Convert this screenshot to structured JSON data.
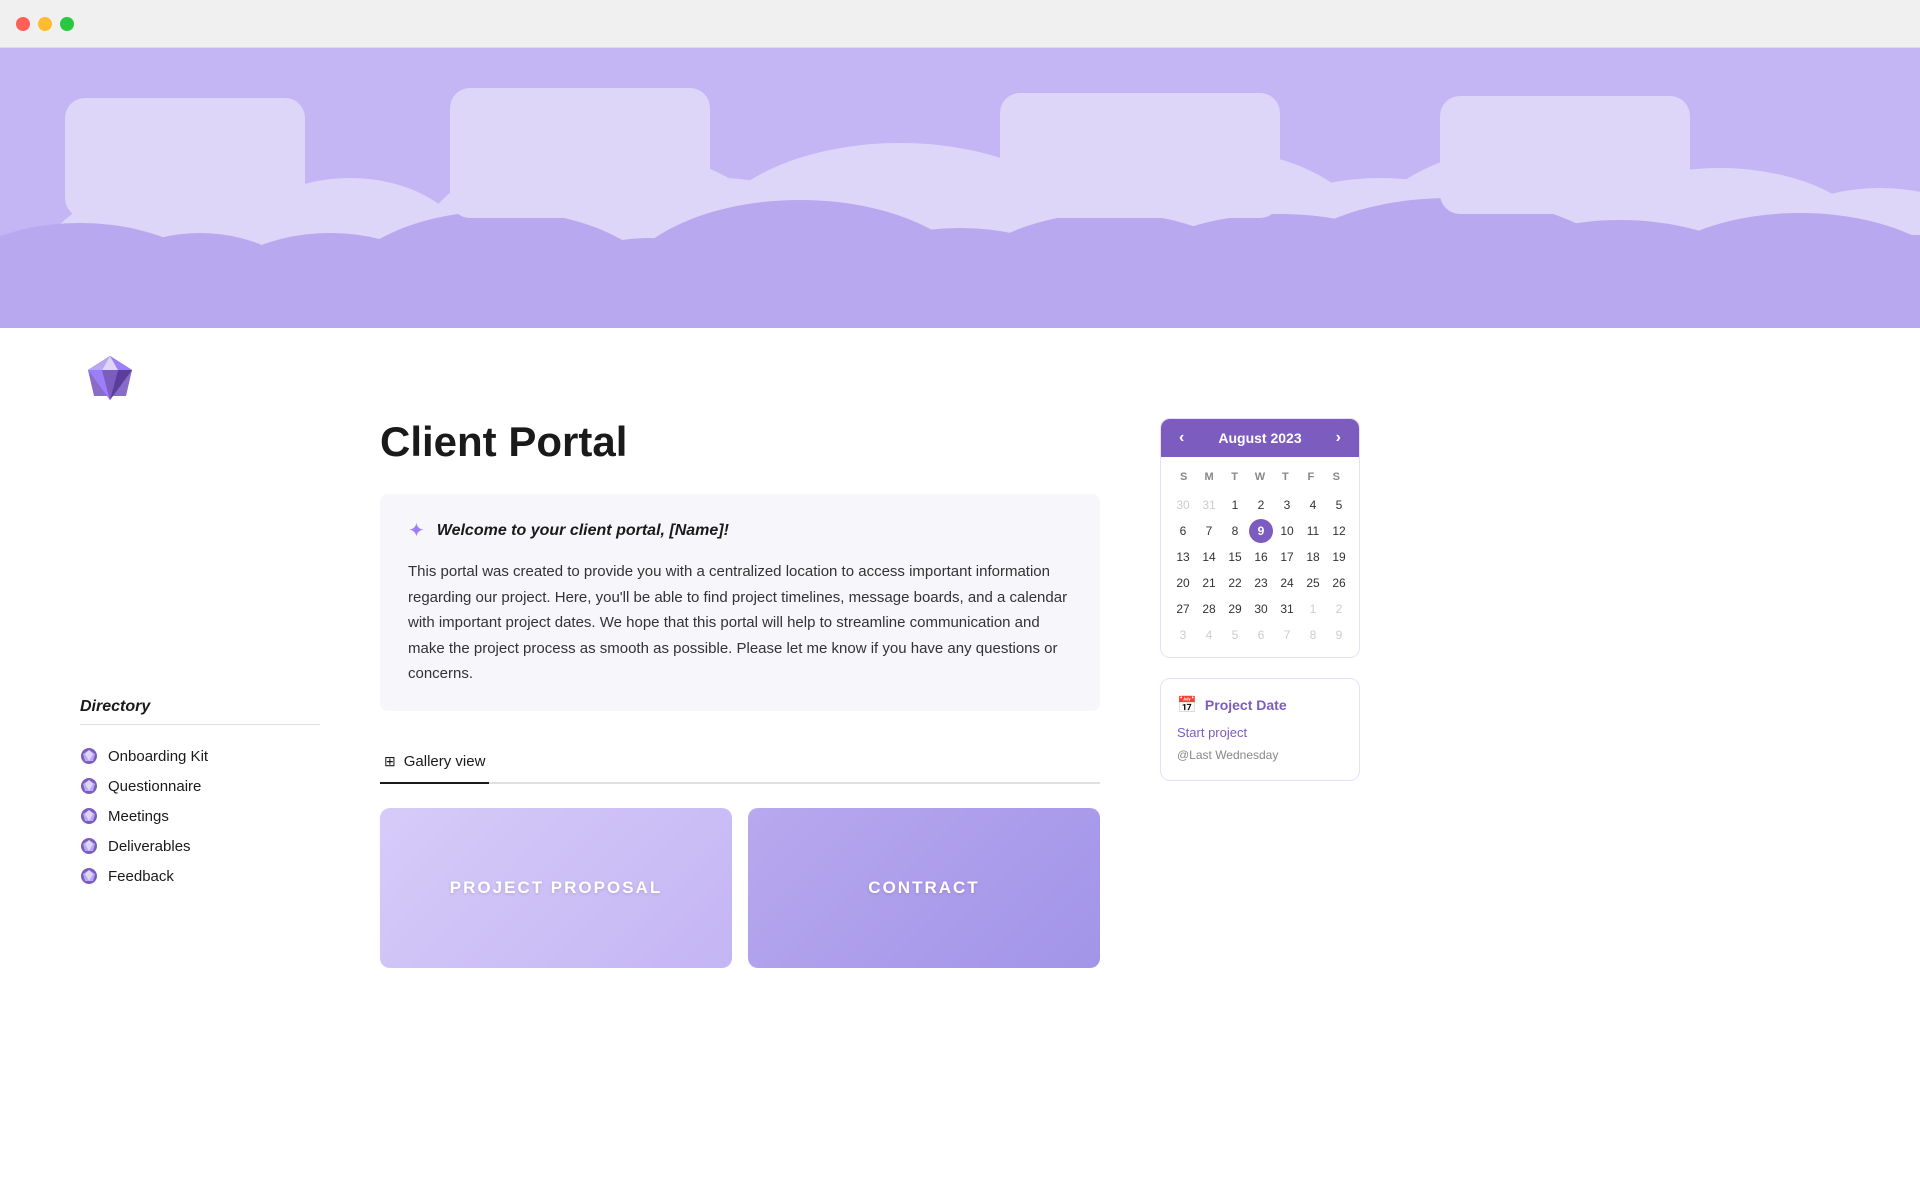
{
  "window": {
    "dots": [
      "red",
      "yellow",
      "green"
    ]
  },
  "banner": {
    "alt": "Purple cloud banner"
  },
  "diamond": {
    "alt": "Diamond gem icon"
  },
  "page": {
    "title": "Client Portal"
  },
  "welcome": {
    "title": "Welcome to your client portal, [Name]!",
    "body": "This portal was created to provide you with a centralized location to access important information regarding our project. Here, you'll be able to find project timelines, message boards, and a calendar with important project dates. We hope that this portal will help to streamline communication and make the project process as smooth as possible. Please let me know if you have any questions or concerns."
  },
  "gallery": {
    "tab_label": "Gallery view",
    "cards": [
      {
        "label": "PROJECT PROPOSAL",
        "style": "proposal"
      },
      {
        "label": "CONTRACT",
        "style": "contract"
      }
    ]
  },
  "sidebar": {
    "title": "Directory",
    "items": [
      {
        "label": "Onboarding Kit"
      },
      {
        "label": "Questionnaire"
      },
      {
        "label": "Meetings"
      },
      {
        "label": "Deliverables"
      },
      {
        "label": "Feedback"
      }
    ]
  },
  "calendar": {
    "month": "August 2023",
    "prev": "‹",
    "next": "›",
    "day_headers": [
      "S",
      "M",
      "T",
      "W",
      "T",
      "F",
      "S"
    ],
    "weeks": [
      [
        {
          "day": "30",
          "muted": true
        },
        {
          "day": "31",
          "muted": true
        },
        {
          "day": "1"
        },
        {
          "day": "2"
        },
        {
          "day": "3"
        },
        {
          "day": "4"
        },
        {
          "day": "5"
        }
      ],
      [
        {
          "day": "6"
        },
        {
          "day": "7"
        },
        {
          "day": "8"
        },
        {
          "day": "9",
          "today": true
        },
        {
          "day": "10"
        },
        {
          "day": "11"
        },
        {
          "day": "12"
        }
      ],
      [
        {
          "day": "13"
        },
        {
          "day": "14"
        },
        {
          "day": "15"
        },
        {
          "day": "16"
        },
        {
          "day": "17"
        },
        {
          "day": "18"
        },
        {
          "day": "19"
        }
      ],
      [
        {
          "day": "20"
        },
        {
          "day": "21"
        },
        {
          "day": "22"
        },
        {
          "day": "23"
        },
        {
          "day": "24"
        },
        {
          "day": "25"
        },
        {
          "day": "26"
        }
      ],
      [
        {
          "day": "27"
        },
        {
          "day": "28"
        },
        {
          "day": "29"
        },
        {
          "day": "30"
        },
        {
          "day": "31"
        },
        {
          "day": "1",
          "muted": true
        },
        {
          "day": "2",
          "muted": true
        }
      ],
      [
        {
          "day": "3",
          "muted": true
        },
        {
          "day": "4",
          "muted": true
        },
        {
          "day": "5",
          "muted": true
        },
        {
          "day": "6",
          "muted": true
        },
        {
          "day": "7",
          "muted": true
        },
        {
          "day": "8",
          "muted": true
        },
        {
          "day": "9",
          "muted": true
        }
      ]
    ]
  },
  "project_date": {
    "title": "Project Date",
    "icon": "📅",
    "start_label": "Start project",
    "sub_label": "@Last Wednesday"
  },
  "colors": {
    "purple_dark": "#7c5cbf",
    "purple_mid": "#9b7ef8",
    "purple_light": "#c4b5f4",
    "purple_pale": "#ddd6f8",
    "banner_bg": "#c4b5f4"
  }
}
